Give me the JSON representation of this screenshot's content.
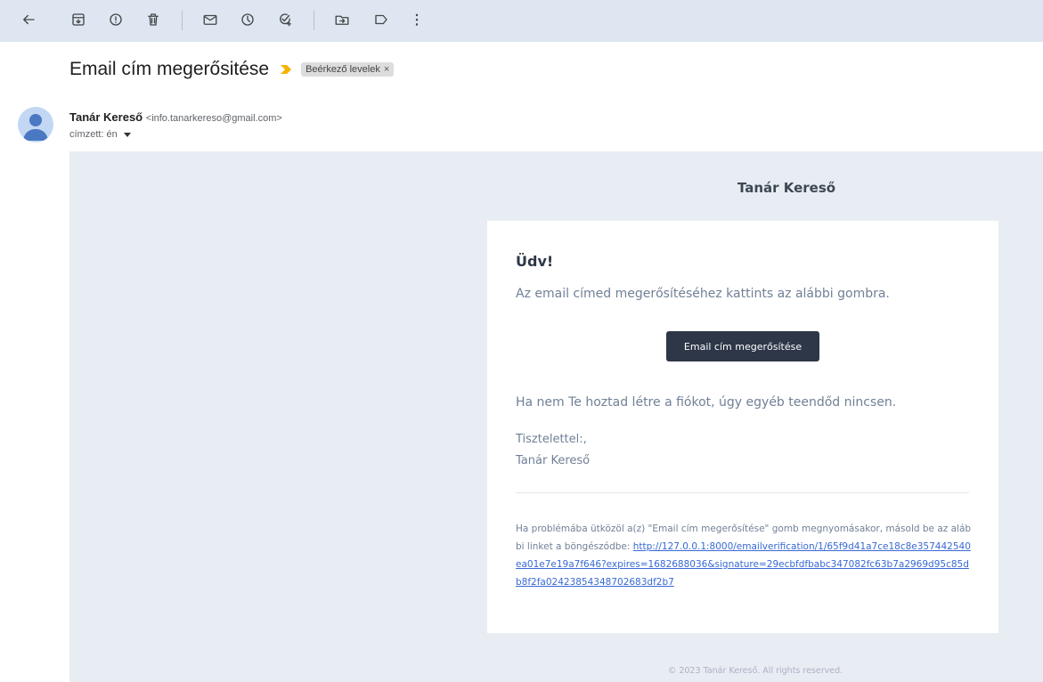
{
  "toolbar": {
    "icons": [
      "back-arrow-icon",
      "archive-icon",
      "report-spam-icon",
      "delete-icon",
      "mark-unread-icon",
      "snooze-icon",
      "add-to-tasks-icon",
      "move-to-icon",
      "label-icon",
      "more-options-icon"
    ]
  },
  "subject": {
    "title": "Email cím megerősitése",
    "label": "Beérkező levelek",
    "label_remove": "×",
    "importance_color": "#f4b400"
  },
  "sender": {
    "name": "Tanár Kereső",
    "email": "<info.tanarkereso@gmail.com>",
    "recipient": "címzett: én"
  },
  "mail": {
    "brand": "Tanár Kereső",
    "greeting": "Üdv!",
    "intro": "Az email címed megerősítéséhez kattints az alábbi gombra.",
    "button_label": "Email cím megerősítése",
    "outro": "Ha nem Te hoztad létre a fiókot, úgy egyéb teendőd nincsen.",
    "salutation": "Tisztelettel:,",
    "signature": "Tanár Kereső",
    "subcopy_text": "Ha problémába ütközöl a(z) \"Email cím megerősítése\" gomb megnyomásakor, másold be az alábbi linket a böngészódbe: ",
    "verification_link": "http://127.0.0.1:8000/emailverification/1/65f9d41a7ce18c8e357442540ea01e7e19a7f646?expires=1682688036&signature=29ecbfdfbabc347082fc63b7a2969d95c85db8f2fa02423854348702683df2b7",
    "footer": "© 2023 Tanár Kereső. All rights reserved."
  },
  "colors": {
    "toolbar_bg": "#dde6f1",
    "body_bg": "#e8edf3",
    "button_bg": "#2d3748",
    "link": "#3869d4"
  }
}
